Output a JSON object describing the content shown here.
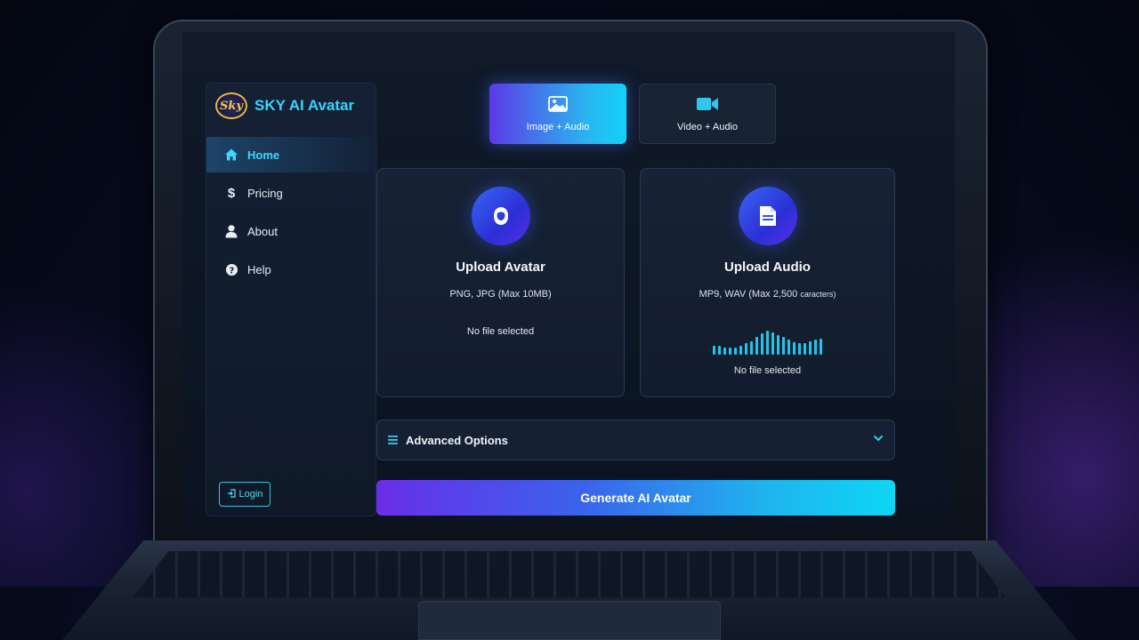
{
  "app": {
    "logo_text": "Sky",
    "title": "SKY AI Avatar"
  },
  "sidebar": {
    "items": [
      {
        "label": "Home",
        "icon": "home-icon",
        "active": true
      },
      {
        "label": "Pricing",
        "icon": "dollar-icon",
        "active": false
      },
      {
        "label": "About",
        "icon": "user-icon",
        "active": false
      },
      {
        "label": "Help",
        "icon": "help-icon",
        "active": false
      }
    ],
    "login_label": "Login"
  },
  "modes": [
    {
      "label": "Image + Audio",
      "icon": "image-icon",
      "active": true
    },
    {
      "label": "Video + Audio",
      "icon": "video-camera-icon",
      "active": false
    }
  ],
  "upload_avatar": {
    "title": "Upload Avatar",
    "formats": "PNG, JPG (Max 10MB)",
    "status": "No file selected",
    "icon": "avatar-face-icon"
  },
  "upload_audio": {
    "title": "Upload Audio",
    "formats_main": "MP9, WAV (Max 2,500",
    "formats_small": "caracters)",
    "status": "No file selected",
    "icon": "document-icon",
    "waveform_levels": [
      0.35,
      0.35,
      0.3,
      0.3,
      0.3,
      0.35,
      0.45,
      0.55,
      0.7,
      0.85,
      0.95,
      0.9,
      0.8,
      0.7,
      0.6,
      0.5,
      0.45,
      0.45,
      0.55,
      0.6,
      0.65
    ]
  },
  "advanced": {
    "label": "Advanced Options"
  },
  "generate": {
    "label": "Generate AI Avatar"
  },
  "colors": {
    "accent": "#35d4ff",
    "gradient_start": "#6a2ee8",
    "gradient_end": "#0ed6f4"
  }
}
